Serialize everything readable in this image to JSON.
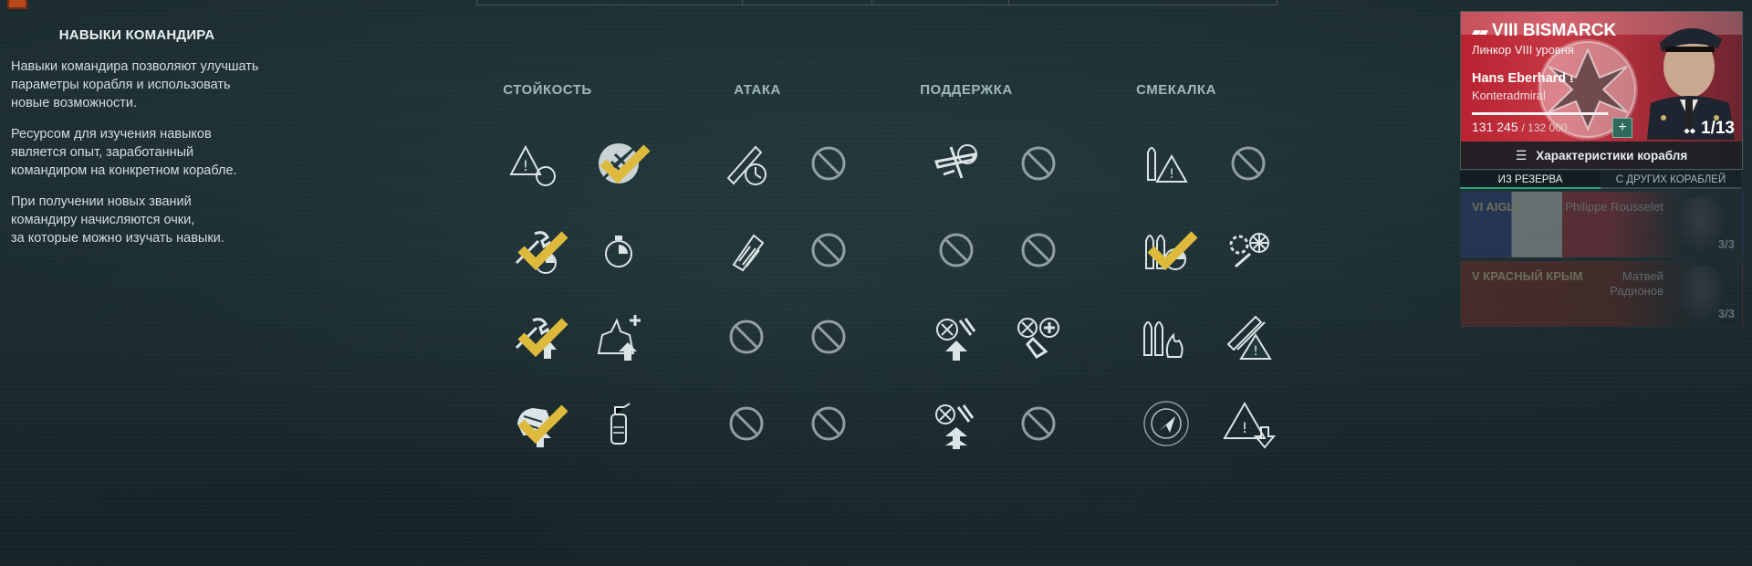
{
  "info": {
    "title": "НАВЫКИ КОМАНДИРА",
    "paragraphs": [
      "Навыки командира позволяют улучшать\nпараметры корабля и использовать\nновые возможности.",
      "Ресурсом для изучения навыков\nявляется опыт, заработанный\nкомандиром на конкретном корабле.",
      "При получении новых званий\nкомандиру начисляются очки,\nза которые можно изучать навыки."
    ]
  },
  "categories": [
    "СТОЙКОСТЬ",
    "АТАКА",
    "ПОДДЕРЖКА",
    "СМЕКАЛКА"
  ],
  "skills": [
    {
      "icon": "warning-range-icon",
      "learned": false,
      "available": true
    },
    {
      "icon": "no-planes-icon",
      "learned": true,
      "available": true
    },
    {
      "icon": "torpedo-time-icon",
      "learned": false,
      "available": true
    },
    {
      "icon": "locked-icon",
      "learned": false,
      "available": false
    },
    {
      "icon": "plane-target-icon",
      "learned": false,
      "available": true
    },
    {
      "icon": "locked-icon",
      "learned": false,
      "available": false
    },
    {
      "icon": "ammo-warning-icon",
      "learned": false,
      "available": true
    },
    {
      "icon": "locked-icon",
      "learned": false,
      "available": false
    },
    {
      "icon": "wrench-timer-icon",
      "learned": true,
      "available": true
    },
    {
      "icon": "stopwatch-icon",
      "learned": false,
      "available": true
    },
    {
      "icon": "shell-fragment-icon",
      "learned": false,
      "available": true
    },
    {
      "icon": "locked-icon",
      "learned": false,
      "available": false
    },
    {
      "icon": "locked-icon",
      "learned": false,
      "available": false
    },
    {
      "icon": "locked-icon",
      "learned": false,
      "available": false
    },
    {
      "icon": "shells-timer-icon",
      "learned": true,
      "available": true
    },
    {
      "icon": "gears-repair-icon",
      "learned": false,
      "available": true
    },
    {
      "icon": "wrench-upgrade-icon",
      "learned": true,
      "available": true
    },
    {
      "icon": "ship-aa-upgrade-icon",
      "learned": false,
      "available": true
    },
    {
      "icon": "locked-icon",
      "learned": false,
      "available": false
    },
    {
      "icon": "locked-icon",
      "learned": false,
      "available": false
    },
    {
      "icon": "aa-guns-upgrade-icon",
      "learned": false,
      "available": true
    },
    {
      "icon": "aa-guns-plus-icon",
      "learned": false,
      "available": true
    },
    {
      "icon": "shells-fire-icon",
      "learned": false,
      "available": true
    },
    {
      "icon": "torpedo-warning-icon",
      "learned": false,
      "available": true
    },
    {
      "icon": "armor-upgrade-icon",
      "learned": true,
      "available": true
    },
    {
      "icon": "extinguisher-icon",
      "learned": false,
      "available": true
    },
    {
      "icon": "locked-icon",
      "learned": false,
      "available": false
    },
    {
      "icon": "locked-icon",
      "learned": false,
      "available": false
    },
    {
      "icon": "aa-guns-double-upgrade-icon",
      "learned": false,
      "available": true
    },
    {
      "icon": "locked-icon",
      "learned": false,
      "available": false
    },
    {
      "icon": "radar-icon",
      "learned": false,
      "available": true
    },
    {
      "icon": "warning-down-icon",
      "learned": false,
      "available": true
    }
  ],
  "ship": {
    "tier_name": "VIII BISMARCK",
    "subtitle": "Линкор VIII уровня",
    "commander_name": "Hans Eberhard",
    "commander_rank": "Konteradmiral",
    "xp_current": "131 245",
    "xp_total": "/ 132 000",
    "xp_progress": 0.994,
    "points": "1/13",
    "footer_label": "Характеристики корабля",
    "flag_color": "#b92230"
  },
  "tabs": [
    "ИЗ РЕЗЕРВА",
    "С ДРУГИХ КОРАБЛЕЙ"
  ],
  "reserve": [
    {
      "ship": "VI AIGLE",
      "name": "Philippe Rousselet",
      "points": "3/3"
    },
    {
      "ship": "V КРАСНЫЙ КРЫМ",
      "name": "Матвей\nРадионов",
      "points": "3/3"
    }
  ],
  "colors": {
    "accent": "#2aa67c",
    "check": "#e8c23c",
    "skill_stroke": "#e6eef0"
  }
}
